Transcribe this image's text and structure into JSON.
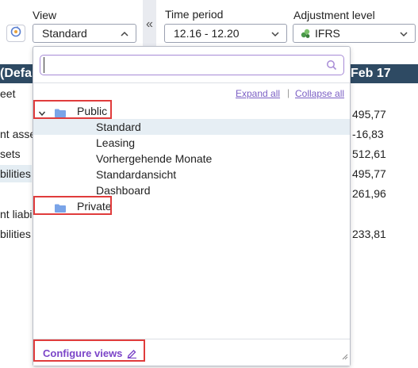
{
  "toolbar": {
    "view": {
      "label": "View",
      "value": "Standard"
    },
    "time_period": {
      "label": "Time period",
      "value": "12.16 - 12.20"
    },
    "adjustment": {
      "label": "Adjustment level",
      "value": "IFRS"
    },
    "collapse_glyph": "«"
  },
  "background_table": {
    "header_left": "(Defau",
    "header_right": "Feb 17",
    "rows": [
      {
        "label": "eet",
        "value": ""
      },
      {
        "label": "",
        "value": "495,77"
      },
      {
        "label": "nt asse",
        "value": "-16,83"
      },
      {
        "label": "sets",
        "value": "512,61"
      },
      {
        "label": "bilities",
        "value": "495,77"
      },
      {
        "label": "",
        "value": "261,96"
      },
      {
        "label": "nt liabi",
        "value": ""
      },
      {
        "label": "bilities",
        "value": "233,81"
      }
    ]
  },
  "dropdown": {
    "search": {
      "value": "",
      "placeholder": ""
    },
    "expand_all": "Expand all",
    "link_separator": "|",
    "collapse_all": "Collapse all",
    "groups": [
      {
        "name": "Public",
        "expanded": true,
        "items": [
          "Standard",
          "Leasing",
          "Vorhergehende Monate",
          "Standardansicht",
          "Dashboard"
        ],
        "selected": "Standard"
      },
      {
        "name": "Private",
        "expanded": false,
        "items": []
      }
    ],
    "configure_label": "Configure views"
  },
  "colors": {
    "accent": "#7b45c8",
    "header_bg": "#2e4a63",
    "selection_bg": "#e6eef4",
    "highlight_red": "#e03c3c",
    "folder": "#7aa4e8"
  }
}
